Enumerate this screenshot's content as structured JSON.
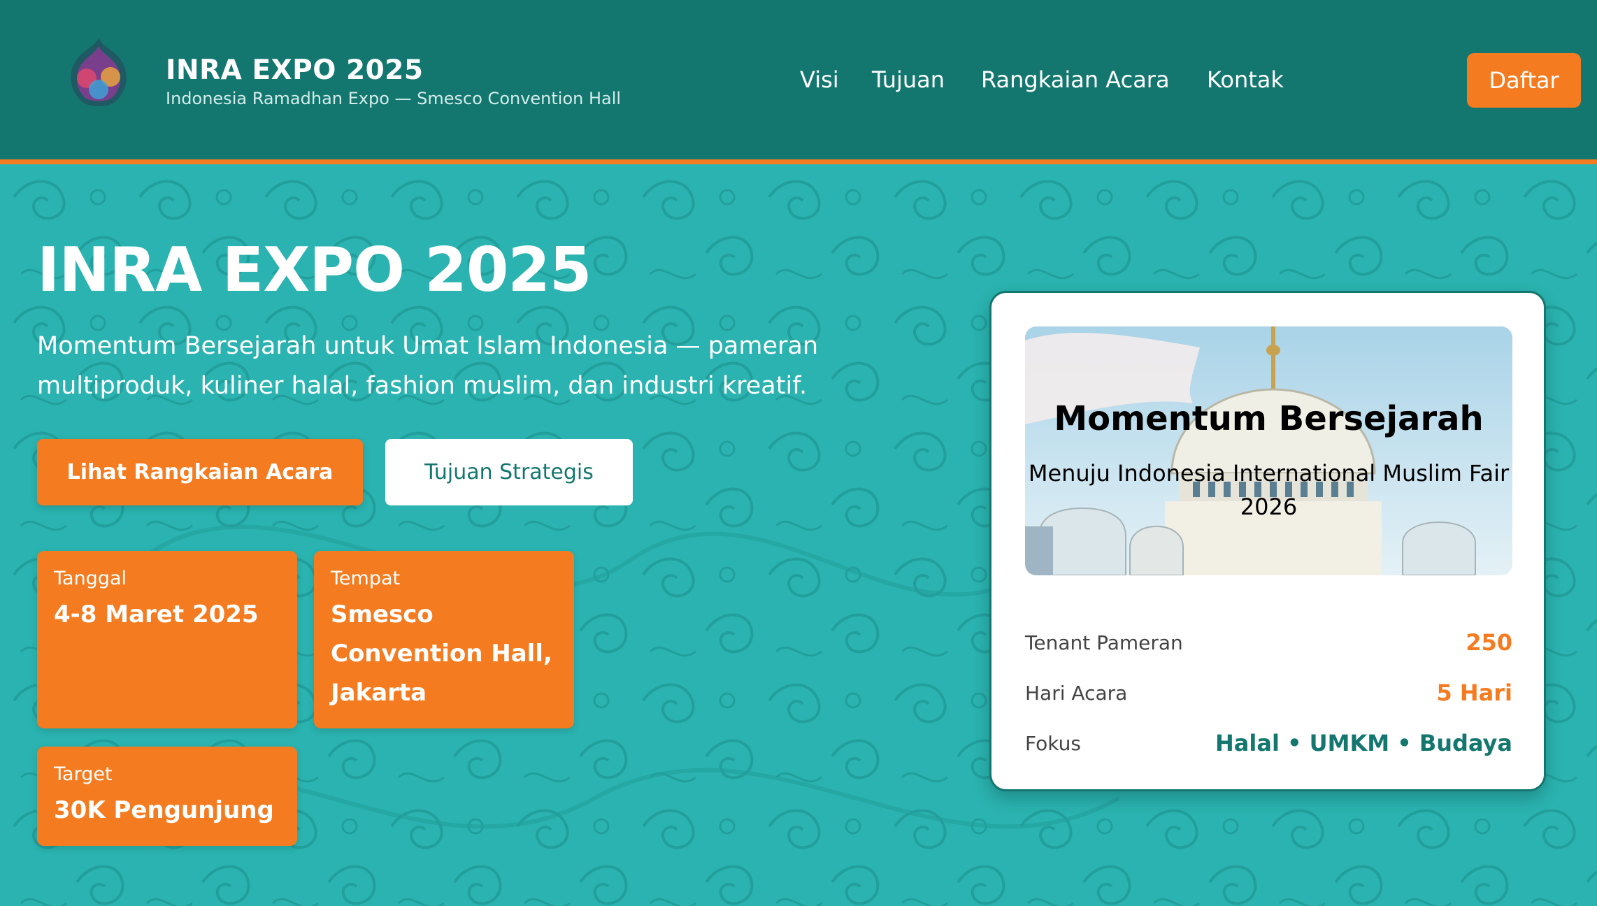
{
  "header": {
    "logo_text": "Indonesia Ramadhan Expo",
    "title": "INRA EXPO 2025",
    "subtitle": "Indonesia Ramadhan Expo — Smesco Convention Hall",
    "nav": [
      "Visi",
      "Tujuan",
      "Rangkaian Acara",
      "Kontak"
    ],
    "cta": "Daftar"
  },
  "hero": {
    "title": "INRA EXPO 2025",
    "description": "Momentum Bersejarah untuk Umat Islam Indonesia — pameran multiproduk, kuliner halal, fashion muslim, dan industri kreatif.",
    "primary_button": "Lihat Rangkaian Acara",
    "secondary_button": "Tujuan Strategis",
    "info": [
      {
        "label": "Tanggal",
        "value": "4-8 Maret 2025"
      },
      {
        "label": "Tempat",
        "value": "Smesco Convention Hall, Jakarta"
      },
      {
        "label": "Target",
        "value": "30K Pengunjung"
      }
    ]
  },
  "panel": {
    "title": "Momentum Bersejarah",
    "subtitle": "Menuju Indonesia International Muslim Fair 2026",
    "stats": [
      {
        "label": "Tenant Pameran",
        "value": "250"
      },
      {
        "label": "Hari Acara",
        "value": "5 Hari"
      },
      {
        "label": "Fokus",
        "value": "Halal • UMKM • Budaya"
      }
    ]
  },
  "colors": {
    "header_bg": "#13776f",
    "accent_orange": "#f47b20",
    "hero_bg": "#2ab3b0",
    "white": "#ffffff"
  }
}
